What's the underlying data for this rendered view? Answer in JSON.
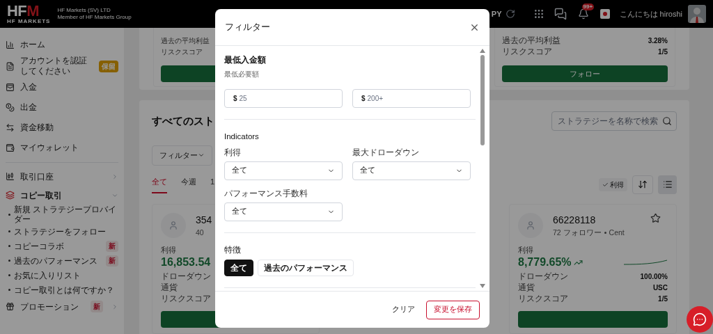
{
  "header": {
    "logo": {
      "mark": "HF",
      "accent": "M",
      "sub": "HF MARKETS"
    },
    "company": [
      "HF Markets (SV) LTD",
      "Member of HF Markets Group"
    ],
    "copy_label": "PY",
    "notification_count": "99+",
    "greeting": "こんにちは hiroshi"
  },
  "sidebar": {
    "primary": [
      {
        "label": "ホーム"
      },
      {
        "label": "アカウントを認証してください",
        "badge": {
          "text": "保留",
          "kind": "pending"
        }
      },
      {
        "label": "入金"
      },
      {
        "label": "出金"
      },
      {
        "label": "資金移動"
      },
      {
        "label": "マイウォレット"
      }
    ],
    "secondary": [
      {
        "label": "取引口座",
        "expanded": false
      },
      {
        "label": "コピー取引",
        "expanded": true,
        "children": [
          {
            "label": "新規 ストラテジープロバイダー"
          },
          {
            "label": "ストラテジーをフォロー"
          },
          {
            "label": "コピーコラボ",
            "badge": {
              "text": "新",
              "kind": "new"
            }
          },
          {
            "label": "過去のパフォーマンス",
            "badge": {
              "text": "新",
              "kind": "new"
            }
          },
          {
            "label": "お気に入りリスト"
          },
          {
            "label": "コピー取引とは何ですか？"
          }
        ]
      },
      {
        "label": "プロモーション",
        "expanded": false,
        "badge": {
          "text": "新",
          "kind": "new"
        }
      }
    ]
  },
  "featured": {
    "cards": [
      {
        "stats": [
          {
            "label": "過去の平均利益"
          },
          {
            "label": "リスクスコア"
          }
        ]
      },
      {
        "stats": [
          {
            "label": "過去の平均利益",
            "value": "3.28%"
          },
          {
            "label": "リスクスコア",
            "value": "1/5"
          }
        ],
        "button": "フォロー"
      }
    ]
  },
  "strategies": {
    "title": "すべてのスト",
    "search": {
      "placeholder": "ストラテジーを名称で検索"
    },
    "filter": "フィルター",
    "periods": [
      {
        "label": "全て",
        "selected": true
      },
      {
        "label": "今週",
        "selected": false
      },
      {
        "label": "1",
        "selected": false
      }
    ],
    "sort_chip": "利得",
    "list_view": {
      "selected": true
    },
    "cards": [
      {
        "name": "354",
        "followers": "40",
        "profit_label": "利得",
        "profit": "16,853.54",
        "stats": [
          {
            "label": "ドローダウン"
          },
          {
            "label": "通貨"
          },
          {
            "label": "リスクスコア"
          }
        ]
      },
      {
        "name": "66228118",
        "followers": "72 フォロワー",
        "account_type": "Cent",
        "favorite": false,
        "profit_label": "利得",
        "profit": "8,779.65%",
        "trend_up": true,
        "stats": [
          {
            "label": "ドローダウン",
            "value": "100.00%"
          },
          {
            "label": "通貨",
            "value": "USC"
          },
          {
            "label": "リスクスコア",
            "value": "1/5"
          }
        ]
      }
    ]
  },
  "modal": {
    "title": "フィルター",
    "deposit": {
      "title": "最低入金額",
      "subtitle": "最低必要額",
      "fields": [
        {
          "prefix": "$",
          "placeholder": "25"
        },
        {
          "prefix": "$",
          "placeholder": "200+"
        }
      ]
    },
    "indicators": {
      "title": "Indicators",
      "selects": [
        {
          "label": "利得",
          "value": "全て"
        },
        {
          "label": "最大ドローダウン",
          "value": "全て"
        },
        {
          "label": "パフォーマンス手数料",
          "value": "全て"
        }
      ]
    },
    "features": {
      "title": "特徴",
      "options": [
        {
          "label": "全て",
          "selected": true
        },
        {
          "label": "過去のパフォーマンス",
          "selected": false
        }
      ]
    },
    "buttons": {
      "clear": "クリア",
      "save": "変更を保存"
    }
  }
}
